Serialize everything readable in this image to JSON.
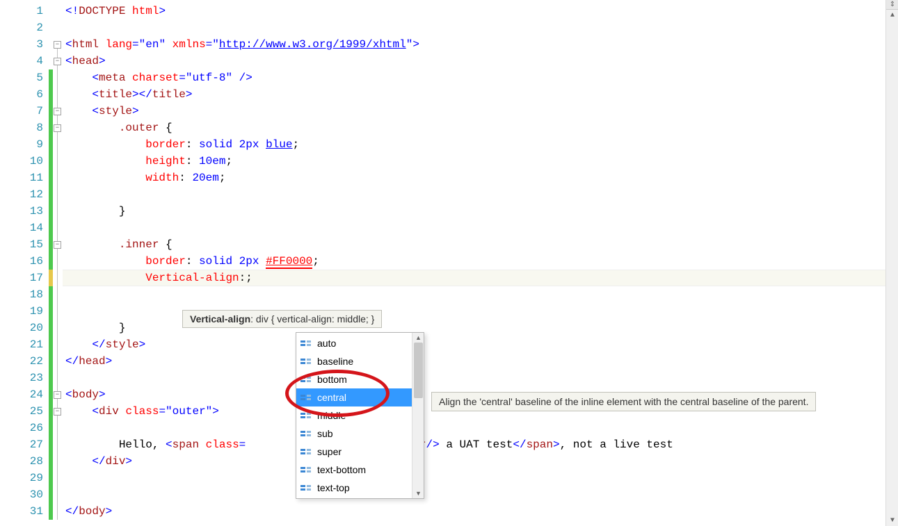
{
  "lines": [
    {
      "n": 1,
      "change": "",
      "fold": "",
      "html": "<span class='t-blue'>&lt;!</span><span class='t-brown'>DOCTYPE</span> <span class='t-red'>html</span><span class='t-blue'>&gt;</span>"
    },
    {
      "n": 2,
      "change": "",
      "fold": "",
      "html": ""
    },
    {
      "n": 3,
      "change": "",
      "fold": "box",
      "html": "<span class='t-blue'>&lt;</span><span class='t-brown'>html</span> <span class='t-red'>lang</span><span class='t-blue'>=\"en\"</span> <span class='t-red'>xmlns</span><span class='t-blue'>=\"</span><span class='t-bluelink'>http://www.w3.org/1999/xhtml</span><span class='t-blue'>\"&gt;</span>"
    },
    {
      "n": 4,
      "change": "",
      "fold": "box-line",
      "html": "<span class='t-blue'>&lt;</span><span class='t-brown'>head</span><span class='t-blue'>&gt;</span>"
    },
    {
      "n": 5,
      "change": "green",
      "fold": "line",
      "html": "    <span class='t-blue'>&lt;</span><span class='t-brown'>meta</span> <span class='t-red'>charset</span><span class='t-blue'>=\"utf-8\" /&gt;</span>"
    },
    {
      "n": 6,
      "change": "green",
      "fold": "line",
      "html": "    <span class='t-blue'>&lt;</span><span class='t-brown'>title</span><span class='t-blue'>&gt;&lt;/</span><span class='t-brown'>title</span><span class='t-blue'>&gt;</span>"
    },
    {
      "n": 7,
      "change": "green",
      "fold": "box-line",
      "html": "    <span class='t-blue'>&lt;</span><span class='t-brown'>style</span><span class='t-blue'>&gt;</span>"
    },
    {
      "n": 8,
      "change": "green",
      "fold": "box-line",
      "html": "        <span class='t-brown'>.outer</span> {"
    },
    {
      "n": 9,
      "change": "green",
      "fold": "line",
      "html": "            <span class='t-red'>border</span>: <span class='t-blue'>solid 2px</span> <span class='t-bluelink'>blue</span>;"
    },
    {
      "n": 10,
      "change": "green",
      "fold": "line",
      "html": "            <span class='t-red'>height</span>: <span class='t-blue'>10em</span>;"
    },
    {
      "n": 11,
      "change": "green",
      "fold": "line",
      "html": "            <span class='t-red'>width</span>: <span class='t-blue'>20em</span>;"
    },
    {
      "n": 12,
      "change": "green",
      "fold": "line",
      "html": ""
    },
    {
      "n": 13,
      "change": "green",
      "fold": "line",
      "html": "        }"
    },
    {
      "n": 14,
      "change": "green",
      "fold": "line",
      "html": ""
    },
    {
      "n": 15,
      "change": "green",
      "fold": "box-line",
      "html": "        <span class='t-brown'>.inner</span> {"
    },
    {
      "n": 16,
      "change": "green",
      "fold": "line",
      "html": "            <span class='t-red'>border</span>: <span class='t-blue'>solid 2px</span> <span class='t-redlink'>#FF0000</span>;"
    },
    {
      "n": 17,
      "change": "yellow",
      "fold": "line",
      "html": "            <span class='t-red'>Vertical-align</span>:;",
      "current": true
    },
    {
      "n": 18,
      "change": "green",
      "fold": "line",
      "html": ""
    },
    {
      "n": 19,
      "change": "green",
      "fold": "line",
      "html": ""
    },
    {
      "n": 20,
      "change": "green",
      "fold": "line",
      "html": "        }"
    },
    {
      "n": 21,
      "change": "green",
      "fold": "line",
      "html": "    <span class='t-blue'>&lt;/</span><span class='t-brown'>style</span><span class='t-blue'>&gt;</span>"
    },
    {
      "n": 22,
      "change": "green",
      "fold": "line",
      "html": "<span class='t-blue'>&lt;/</span><span class='t-brown'>head</span><span class='t-blue'>&gt;</span>"
    },
    {
      "n": 23,
      "change": "green",
      "fold": "line",
      "html": ""
    },
    {
      "n": 24,
      "change": "green",
      "fold": "box-line",
      "html": "<span class='t-blue'>&lt;</span><span class='t-brown'>body</span><span class='t-blue'>&gt;</span>"
    },
    {
      "n": 25,
      "change": "green",
      "fold": "box-line",
      "html": "    <span class='t-blue'>&lt;</span><span class='t-brown'>div</span> <span class='t-red'>class</span><span class='t-blue'>=\"outer\"&gt;</span>"
    },
    {
      "n": 26,
      "change": "green",
      "fold": "line",
      "html": ""
    },
    {
      "n": 27,
      "change": "green",
      "fold": "line",
      "html": "        Hello, <span class='t-blue'>&lt;</span><span class='t-brown'>span</span> <span class='t-red'>class</span><span class='t-blue'>=</span>                   test.<span class='t-blue'>&lt;</span><span class='t-brown'>br</span><span class='t-blue'>/&gt;</span> a UAT test<span class='t-blue'>&lt;/</span><span class='t-brown'>span</span><span class='t-blue'>&gt;</span>, not a live test"
    },
    {
      "n": 28,
      "change": "green",
      "fold": "line",
      "html": "    <span class='t-blue'>&lt;/</span><span class='t-brown'>div</span><span class='t-blue'>&gt;</span>"
    },
    {
      "n": 29,
      "change": "green",
      "fold": "line",
      "html": ""
    },
    {
      "n": 30,
      "change": "green",
      "fold": "line",
      "html": ""
    },
    {
      "n": 31,
      "change": "green",
      "fold": "line",
      "html": "<span class='t-blue'>&lt;/</span><span class='t-brown'>body</span><span class='t-blue'>&gt;</span>"
    }
  ],
  "hint": {
    "bold": "Vertical-align",
    "rest": ": div { vertical-align: middle; }"
  },
  "popup": {
    "items": [
      {
        "label": "auto",
        "selected": false
      },
      {
        "label": "baseline",
        "selected": false
      },
      {
        "label": "bottom",
        "selected": false
      },
      {
        "label": "central",
        "selected": true
      },
      {
        "label": "middle",
        "selected": false
      },
      {
        "label": "sub",
        "selected": false
      },
      {
        "label": "super",
        "selected": false
      },
      {
        "label": "text-bottom",
        "selected": false
      },
      {
        "label": "text-top",
        "selected": false
      }
    ]
  },
  "side_tip": "Align the 'central' baseline of the inline element with the central baseline of the parent."
}
